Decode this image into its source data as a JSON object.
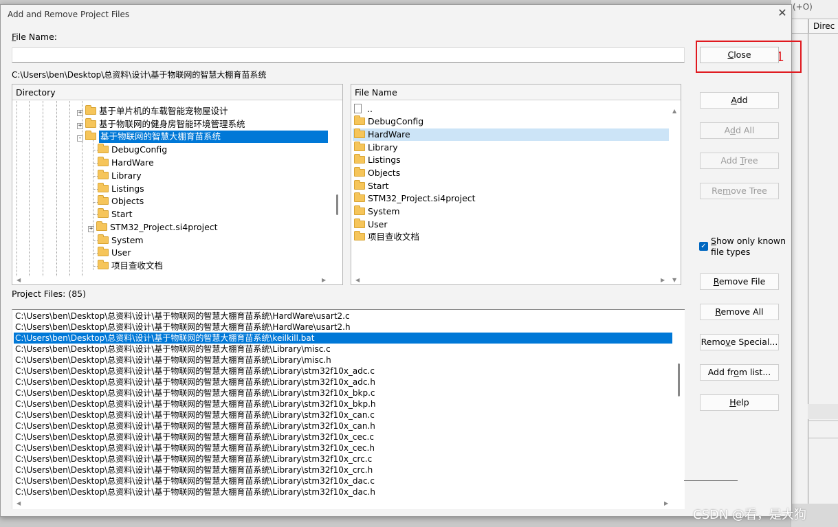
{
  "dialog": {
    "title": "Add and Remove Project Files",
    "close_glyph": "✕",
    "file_name_label_key": "F",
    "file_name_label_rest": "ile Name:",
    "file_name_value": "",
    "current_path": "C:\\Users\\ben\\Desktop\\总资料\\设计\\基于物联网的智慧大棚育苗系统"
  },
  "directory_pane": {
    "header": "Directory",
    "items": [
      {
        "label": "基于单片机的车载智能宠物屋设计",
        "expander": "+"
      },
      {
        "label": "基于物联网的健身房智能环境管理系统",
        "expander": "+"
      },
      {
        "label": "基于物联网的智慧大棚育苗系统",
        "expander": "-",
        "selected": true
      },
      {
        "label": "DebugConfig"
      },
      {
        "label": "HardWare"
      },
      {
        "label": "Library"
      },
      {
        "label": "Listings"
      },
      {
        "label": "Objects"
      },
      {
        "label": "Start"
      },
      {
        "label": "STM32_Project.si4project",
        "expander": "+"
      },
      {
        "label": "System"
      },
      {
        "label": "User"
      },
      {
        "label": "项目查收文档"
      }
    ]
  },
  "file_pane": {
    "header": "File Name",
    "items": [
      {
        "label": "..",
        "icon": "file-icon"
      },
      {
        "label": "DebugConfig",
        "icon": "folder-icon"
      },
      {
        "label": "HardWare",
        "icon": "folder-icon",
        "selected": true
      },
      {
        "label": "Library",
        "icon": "folder-icon"
      },
      {
        "label": "Listings",
        "icon": "folder-icon"
      },
      {
        "label": "Objects",
        "icon": "folder-icon"
      },
      {
        "label": "Start",
        "icon": "folder-icon"
      },
      {
        "label": "STM32_Project.si4project",
        "icon": "folder-icon"
      },
      {
        "label": "System",
        "icon": "folder-icon"
      },
      {
        "label": "User",
        "icon": "folder-icon"
      },
      {
        "label": "项目查收文档",
        "icon": "folder-icon"
      }
    ]
  },
  "project_files": {
    "label": "Project Files: (85)",
    "items": [
      "C:\\Users\\ben\\Desktop\\总资料\\设计\\基于物联网的智慧大棚育苗系统\\HardWare\\usart2.c",
      "C:\\Users\\ben\\Desktop\\总资料\\设计\\基于物联网的智慧大棚育苗系统\\HardWare\\usart2.h",
      "C:\\Users\\ben\\Desktop\\总资料\\设计\\基于物联网的智慧大棚育苗系统\\keilkill.bat",
      "C:\\Users\\ben\\Desktop\\总资料\\设计\\基于物联网的智慧大棚育苗系统\\Library\\misc.c",
      "C:\\Users\\ben\\Desktop\\总资料\\设计\\基于物联网的智慧大棚育苗系统\\Library\\misc.h",
      "C:\\Users\\ben\\Desktop\\总资料\\设计\\基于物联网的智慧大棚育苗系统\\Library\\stm32f10x_adc.c",
      "C:\\Users\\ben\\Desktop\\总资料\\设计\\基于物联网的智慧大棚育苗系统\\Library\\stm32f10x_adc.h",
      "C:\\Users\\ben\\Desktop\\总资料\\设计\\基于物联网的智慧大棚育苗系统\\Library\\stm32f10x_bkp.c",
      "C:\\Users\\ben\\Desktop\\总资料\\设计\\基于物联网的智慧大棚育苗系统\\Library\\stm32f10x_bkp.h",
      "C:\\Users\\ben\\Desktop\\总资料\\设计\\基于物联网的智慧大棚育苗系统\\Library\\stm32f10x_can.c",
      "C:\\Users\\ben\\Desktop\\总资料\\设计\\基于物联网的智慧大棚育苗系统\\Library\\stm32f10x_can.h",
      "C:\\Users\\ben\\Desktop\\总资料\\设计\\基于物联网的智慧大棚育苗系统\\Library\\stm32f10x_cec.c",
      "C:\\Users\\ben\\Desktop\\总资料\\设计\\基于物联网的智慧大棚育苗系统\\Library\\stm32f10x_cec.h",
      "C:\\Users\\ben\\Desktop\\总资料\\设计\\基于物联网的智慧大棚育苗系统\\Library\\stm32f10x_crc.c",
      "C:\\Users\\ben\\Desktop\\总资料\\设计\\基于物联网的智慧大棚育苗系统\\Library\\stm32f10x_crc.h",
      "C:\\Users\\ben\\Desktop\\总资料\\设计\\基于物联网的智慧大棚育苗系统\\Library\\stm32f10x_dac.c",
      "C:\\Users\\ben\\Desktop\\总资料\\设计\\基于物联网的智慧大棚育苗系统\\Library\\stm32f10x_dac.h"
    ],
    "selected_index": 2
  },
  "buttons": {
    "close": {
      "key": "C",
      "rest": "lose"
    },
    "add": {
      "key": "A",
      "rest": "dd"
    },
    "add_all": {
      "pre": "A",
      "key": "d",
      "rest": "d All"
    },
    "add_tree": {
      "pre": "Add ",
      "key": "T",
      "rest": "ree"
    },
    "remove_tree": {
      "pre": "Re",
      "key": "m",
      "rest": "ove Tree"
    },
    "remove_file": {
      "pre": "",
      "key": "R",
      "rest": "emove File"
    },
    "remove_all": {
      "pre": "",
      "key": "R",
      "rest": "emove All"
    },
    "remove_special": {
      "pre": "Remo",
      "key": "v",
      "rest": "e Special..."
    },
    "add_from_list": {
      "pre": "Add fr",
      "key": "o",
      "rest": "m list..."
    },
    "help": {
      "pre": "",
      "key": "H",
      "rest": "elp"
    }
  },
  "show_known_types": {
    "checked": true,
    "label_key": "S",
    "label_rest": "how only known file types"
  },
  "annotation": {
    "number": "1",
    "color": "#e0181e"
  },
  "background_app": {
    "header_fragment": "(+O)",
    "column_header": "Direc"
  },
  "watermark": "CSDN @看，是大狗",
  "colors": {
    "selection": "#0078d7",
    "light_selection": "#cce4f7",
    "highlight": "#e0181e"
  }
}
